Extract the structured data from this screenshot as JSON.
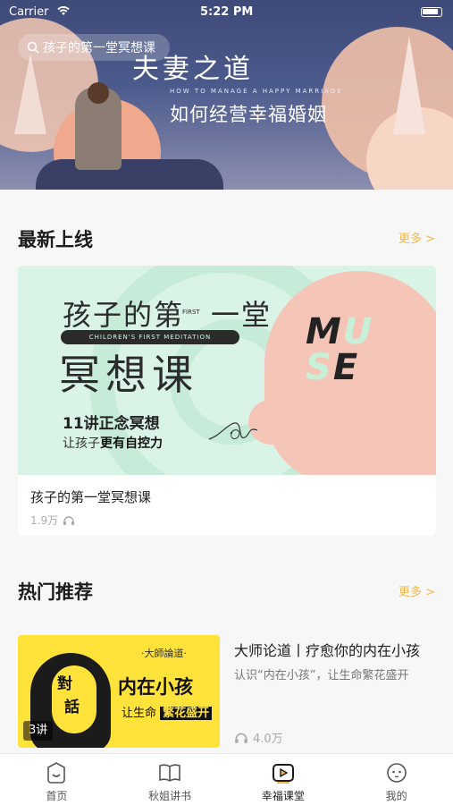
{
  "status_bar": {
    "carrier": "Carrier",
    "time": "5:22 PM"
  },
  "search": {
    "placeholder": "孩子的第一堂冥想课"
  },
  "banner": {
    "title": "夫妻之道",
    "subtitle_en": "HOW TO MANAGE A HAPPY MARRIAGE",
    "subtitle": "如何经营幸福婚姻"
  },
  "latest": {
    "heading": "最新上线",
    "more": "更多 >",
    "course": {
      "cover": {
        "line1": "孩子的第",
        "first": "FIRST",
        "line1b": "一堂",
        "en": "CHILDREN'S FIRST MEDITATION",
        "line2": "冥想课",
        "line3": "11讲正念冥想",
        "line4_a": "让孩子",
        "line4_b": "更有自控力",
        "brand_m": "M",
        "brand_u": "U",
        "brand_s": "S",
        "brand_e": "E"
      },
      "title": "孩子的第一堂冥想课",
      "plays": "1.9万"
    }
  },
  "hot": {
    "heading": "热门推荐",
    "more": "更多 >",
    "items": [
      {
        "thumb": {
          "ch1": "對",
          "ch2": "話",
          "small": "·大師論道·",
          "big": "内在小孩",
          "line2_a": "让生命",
          "line2_b": "繁花盛开",
          "lessons": "3讲"
        },
        "title": "大师论道丨疗愈你的内在小孩",
        "desc": "认识“内在小孩”，让生命繁花盛开",
        "plays": "4.0万"
      }
    ]
  },
  "tabbar": {
    "tabs": [
      {
        "label": "首页",
        "icon": "home-icon"
      },
      {
        "label": "秋姐讲书",
        "icon": "book-icon"
      },
      {
        "label": "幸福课堂",
        "icon": "play-icon"
      },
      {
        "label": "我的",
        "icon": "face-icon"
      }
    ]
  },
  "colors": {
    "accent": "#f2b84b",
    "active_tab": "#1c1c1c"
  }
}
